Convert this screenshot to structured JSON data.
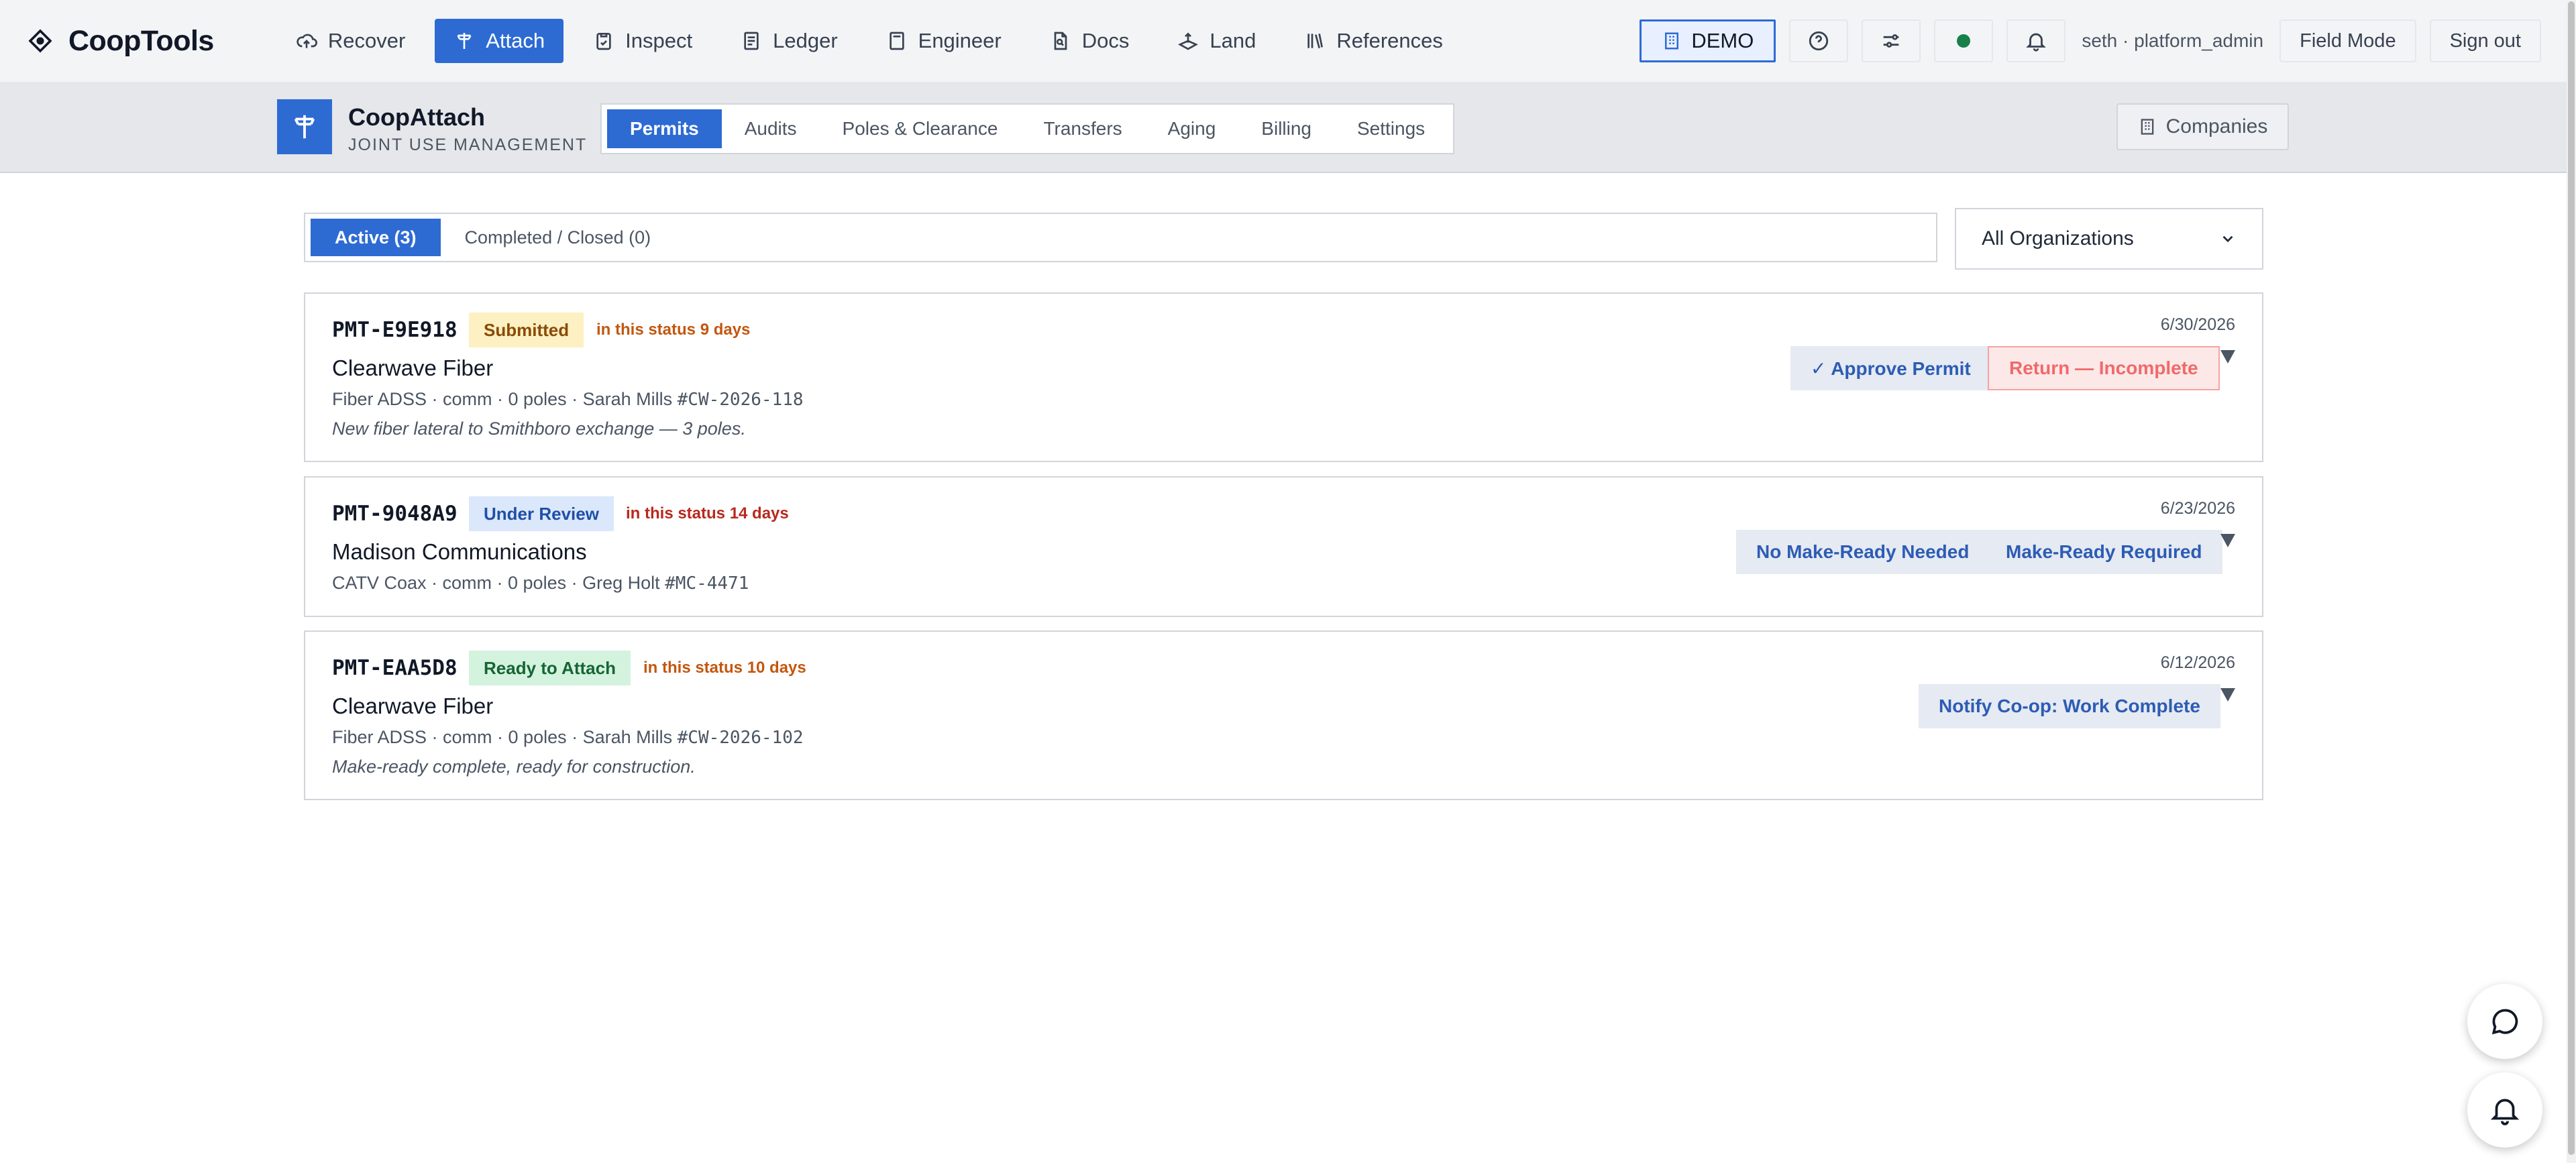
{
  "app": {
    "brand": "CoopTools",
    "nav": [
      {
        "label": "Recover",
        "icon": "cloud-upload-icon"
      },
      {
        "label": "Attach",
        "icon": "utility-pole-icon",
        "active": true
      },
      {
        "label": "Inspect",
        "icon": "clipboard-check-icon"
      },
      {
        "label": "Ledger",
        "icon": "ledger-icon"
      },
      {
        "label": "Engineer",
        "icon": "calculator-icon"
      },
      {
        "label": "Docs",
        "icon": "document-search-icon"
      },
      {
        "label": "Land",
        "icon": "land-icon"
      },
      {
        "label": "References",
        "icon": "library-icon"
      }
    ],
    "demo_label": "DEMO",
    "user": "seth · platform_admin",
    "field_mode": "Field Mode",
    "sign_out": "Sign out",
    "status_color": "#16804a"
  },
  "module": {
    "title": "CoopAttach",
    "subtitle": "JOINT USE MANAGEMENT",
    "tabs": [
      "Permits",
      "Audits",
      "Poles & Clearance",
      "Transfers",
      "Aging",
      "Billing",
      "Settings"
    ],
    "active_tab": "Permits",
    "companies_label": "Companies"
  },
  "filters": {
    "active_tab": "Active (3)",
    "closed_tab": "Completed / Closed (0)",
    "org_select": "All Organizations"
  },
  "permits": [
    {
      "id": "PMT-E9E918",
      "status": "Submitted",
      "since": "in this status 9 days",
      "company": "Clearwave Fiber",
      "meta": "Fiber ADSS · comm · 0 poles · Sarah Mills",
      "ref": "#CW-2026-118",
      "note": "New fiber lateral to Smithboro exchange — 3 poles.",
      "date": "6/30/2026",
      "actions": [
        "✓ Approve Permit",
        "Return — Incomplete"
      ]
    },
    {
      "id": "PMT-9048A9",
      "status": "Under Review",
      "since": "in this status 14 days",
      "company": "Madison Communications",
      "meta": "CATV Coax · comm · 0 poles · Greg Holt",
      "ref": "#MC-4471",
      "note": "",
      "date": "6/23/2026",
      "actions": [
        "No Make-Ready Needed",
        "Make-Ready Required"
      ]
    },
    {
      "id": "PMT-EAA5D8",
      "status": "Ready to Attach",
      "since": "in this status 10 days",
      "company": "Clearwave Fiber",
      "meta": "Fiber ADSS · comm · 0 poles · Sarah Mills",
      "ref": "#CW-2026-102",
      "note": "Make-ready complete, ready for construction.",
      "date": "6/12/2026",
      "actions": [
        "Notify Co-op: Work Complete"
      ]
    }
  ],
  "colors": {
    "accent": "#2d6bd3",
    "submitted": "#fdf0c2",
    "under_review": "#dbe8fb",
    "ready": "#d4f3df"
  }
}
